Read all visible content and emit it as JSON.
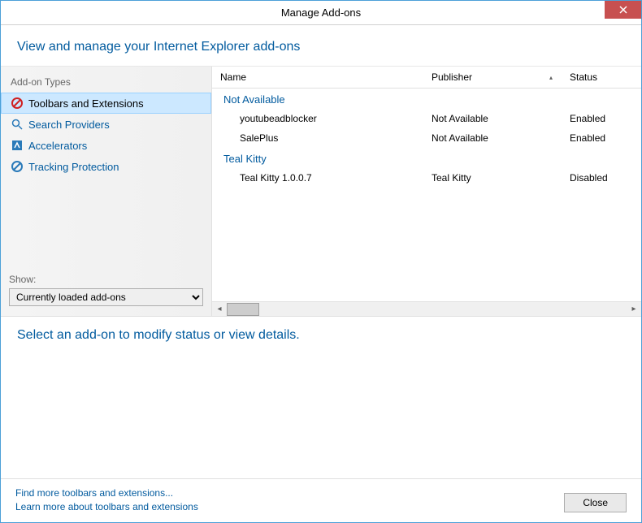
{
  "window": {
    "title": "Manage Add-ons"
  },
  "header": {
    "title": "View and manage your Internet Explorer add-ons"
  },
  "sidebar": {
    "heading": "Add-on Types",
    "items": [
      {
        "label": "Toolbars and Extensions"
      },
      {
        "label": "Search Providers"
      },
      {
        "label": "Accelerators"
      },
      {
        "label": "Tracking Protection"
      }
    ],
    "show_label": "Show:",
    "show_value": "Currently loaded add-ons"
  },
  "table": {
    "columns": {
      "name": "Name",
      "publisher": "Publisher",
      "status": "Status"
    },
    "groups": [
      {
        "title": "Not Available",
        "rows": [
          {
            "name": "youtubeadblocker",
            "publisher": "Not Available",
            "status": "Enabled"
          },
          {
            "name": "SalePlus",
            "publisher": "Not Available",
            "status": "Enabled"
          }
        ]
      },
      {
        "title": "Teal Kitty",
        "rows": [
          {
            "name": "Teal Kitty 1.0.0.7",
            "publisher": "Teal Kitty",
            "status": "Disabled"
          }
        ]
      }
    ]
  },
  "detail": {
    "prompt": "Select an add-on to modify status or view details."
  },
  "footer": {
    "link_find": "Find more toolbars and extensions...",
    "link_learn": "Learn more about toolbars and extensions",
    "close_label": "Close"
  }
}
